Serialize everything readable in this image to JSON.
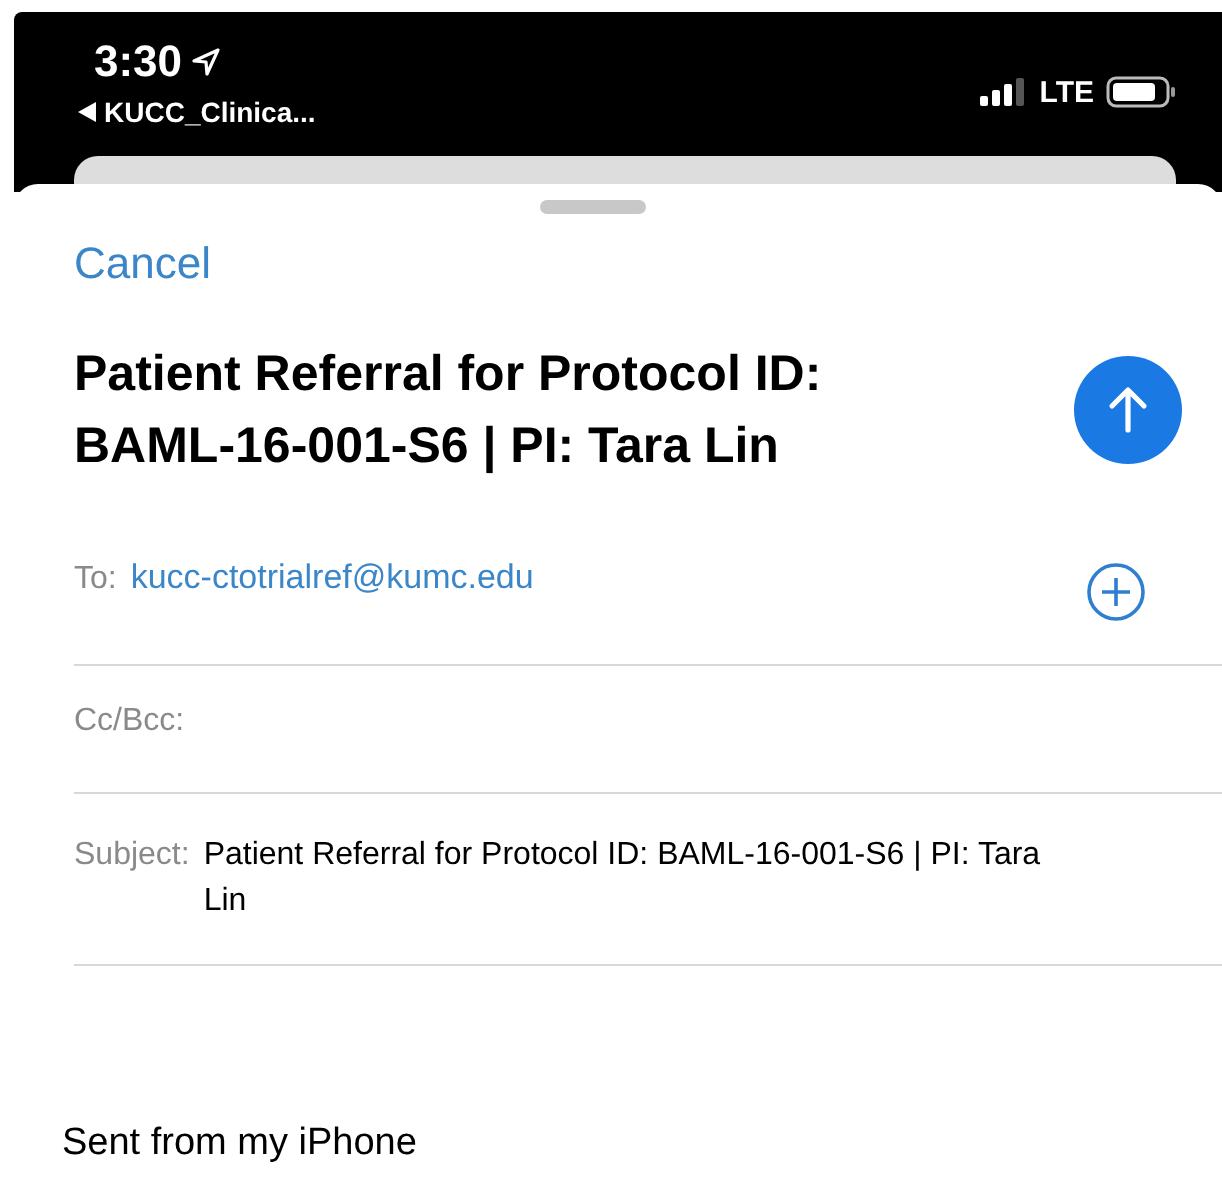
{
  "status_bar": {
    "time": "3:30",
    "back_app": "KUCC_Clinica...",
    "network": "LTE"
  },
  "compose": {
    "cancel": "Cancel",
    "title": "Patient Referral for Protocol ID: BAML-16-001-S6 | PI: Tara Lin",
    "to_label": "To:",
    "to_value": "kucc-ctotrialref@kumc.edu",
    "cc_label": "Cc/Bcc:",
    "subject_label": "Subject:",
    "subject_value": "Patient Referral for Protocol ID: BAML-16-001-S6 | PI: Tara Lin",
    "body": "Sent from my iPhone"
  }
}
